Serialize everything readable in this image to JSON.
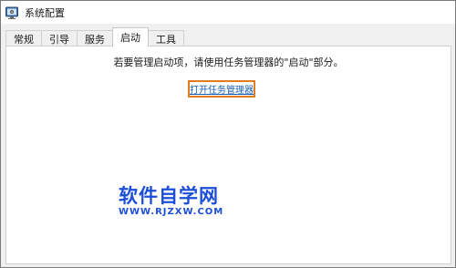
{
  "window": {
    "title": "系统配置",
    "icon": "system-config-icon"
  },
  "tabs": [
    {
      "label": "常规",
      "active": false
    },
    {
      "label": "引导",
      "active": false
    },
    {
      "label": "服务",
      "active": false
    },
    {
      "label": "启动",
      "active": true
    },
    {
      "label": "工具",
      "active": false
    }
  ],
  "startup": {
    "message": "若要管理启动项，请使用任务管理器的\"启动\"部分。",
    "link_label": "打开任务管理器",
    "highlight_color": "#e07b1f"
  },
  "watermark": {
    "main": "软件自学网",
    "sub": "WWW.RJZXW.COM",
    "color": "#1c4fd6"
  }
}
